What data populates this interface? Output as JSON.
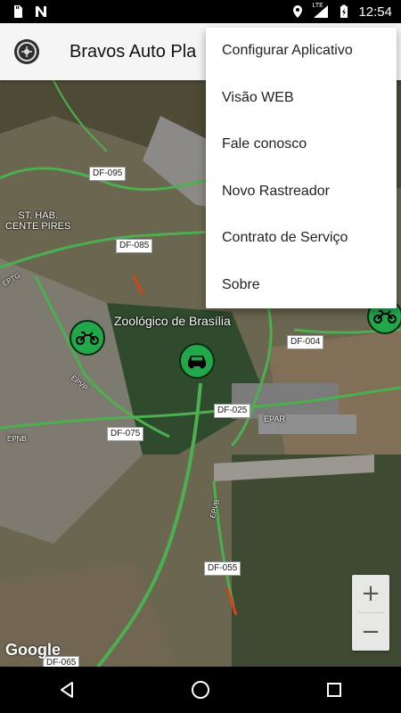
{
  "status_bar": {
    "time": "12:54",
    "network_label": "LTE",
    "icons": [
      "sd-card-icon",
      "n-notification-icon",
      "location-icon",
      "signal-icon",
      "battery-charging-icon"
    ]
  },
  "app_bar": {
    "title": "Bravos Auto Pla",
    "logo_icon": "app-logo-icon"
  },
  "menu": {
    "items": [
      {
        "label": "Configurar Aplicativo"
      },
      {
        "label": "Visão WEB"
      },
      {
        "label": "Fale conosco"
      },
      {
        "label": "Novo Rastreador"
      },
      {
        "label": "Contrato de Serviço"
      },
      {
        "label": "Sobre"
      }
    ]
  },
  "map": {
    "place_labels": {
      "st_hab_line1": "ST. HAB.",
      "st_hab_line2": "CENTE PIRES",
      "zoo": "Zoológico de Brasília",
      "epar": "EPAR"
    },
    "road_labels": {
      "df095": "DF-095",
      "df085": "DF-085",
      "df004": "DF-004",
      "df025": "DF-025",
      "df075": "DF-075",
      "df055": "DF-055",
      "df065": "DF-065",
      "eptg": "EPTG",
      "epvp": "EPVP",
      "epnb": "EPNB",
      "epvb": "EPVB"
    },
    "markers": [
      "motorcycle-icon",
      "car-icon",
      "motorcycle-icon"
    ],
    "attribution": "Google",
    "zoom_in": "+",
    "zoom_out": "−"
  },
  "nav_bar": {
    "icons": [
      "back-icon",
      "home-icon",
      "recents-icon"
    ]
  },
  "colors": {
    "marker_green": "#22a84b",
    "road_green": "#4caf50",
    "app_bar_bg": "#f5f5f5"
  }
}
